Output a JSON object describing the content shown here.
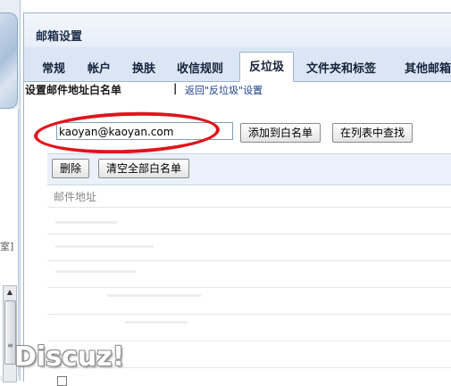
{
  "panel": {
    "title": "邮箱设置"
  },
  "tabs": [
    {
      "label": "常规"
    },
    {
      "label": "帐户"
    },
    {
      "label": "换肤"
    },
    {
      "label": "收信规则"
    },
    {
      "label": "反垃圾",
      "active": true
    },
    {
      "label": "文件夹和标签"
    },
    {
      "label": "其他邮箱"
    }
  ],
  "section": {
    "title": "设置邮件地址白名单",
    "separator": "|",
    "return_link": "返回\"反垃圾\"设置"
  },
  "form": {
    "email_value": "kaoyan@kaoyan.com",
    "add_button": "添加到白名单",
    "find_button": "在列表中查找"
  },
  "toolbar": {
    "delete_button": "删除",
    "clear_button": "清空全部白名单"
  },
  "list": {
    "column_header": "邮件地址"
  },
  "left": {
    "bracket_text": "室]"
  },
  "watermark": "Discuz!",
  "colors": {
    "highlight_ring": "#e1141c",
    "tab_bar": "#dbe6f5",
    "link": "#1b3f8e"
  }
}
